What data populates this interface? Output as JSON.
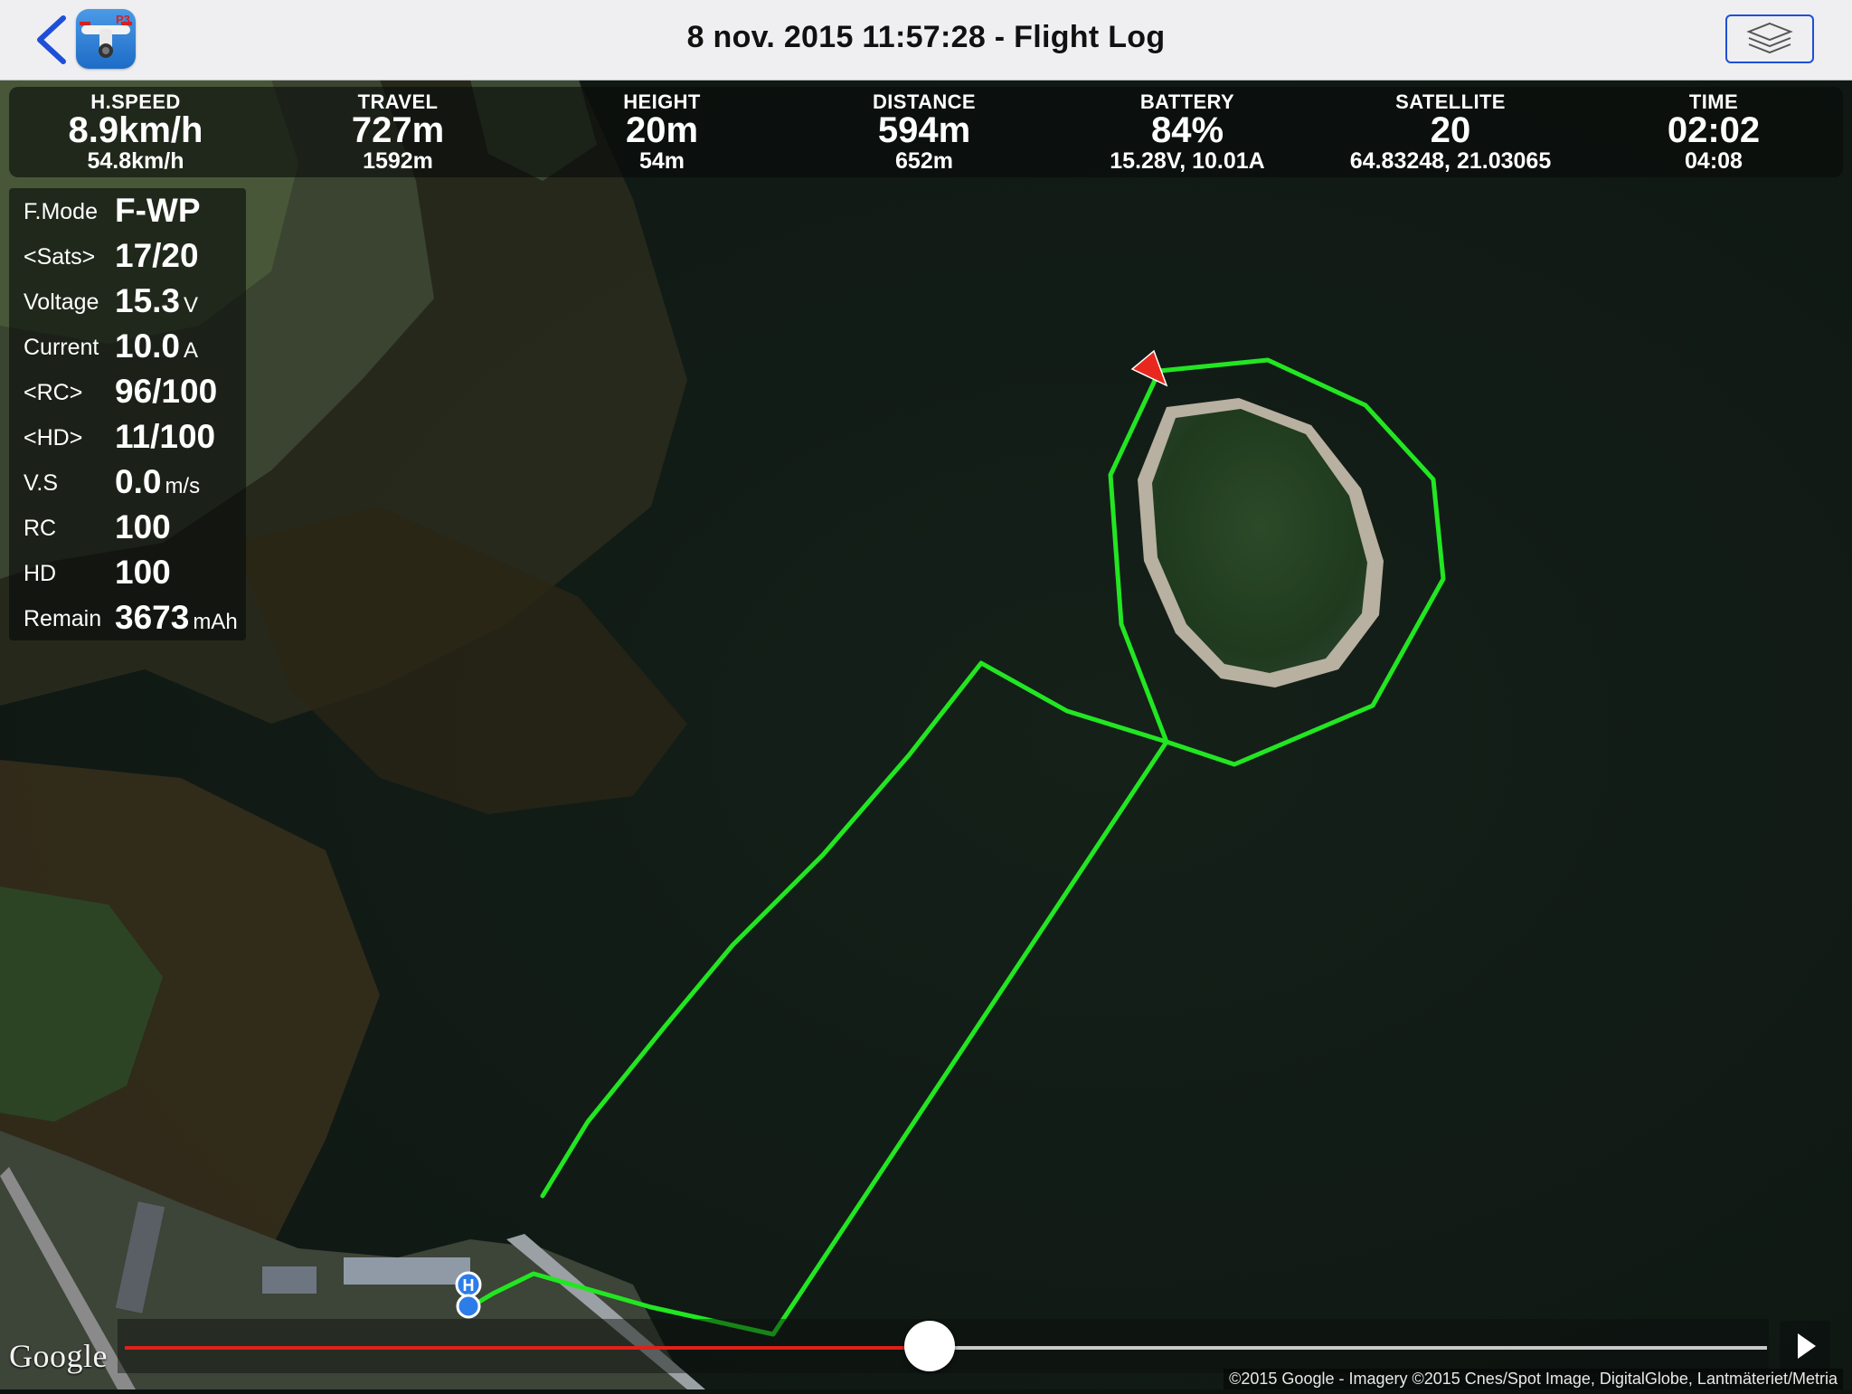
{
  "header": {
    "title": "8 nov. 2015 11:57:28 - Flight Log",
    "app_icon_badge": "P3",
    "back_icon": "chevron-left-icon",
    "layers_icon": "layers-icon"
  },
  "stats": [
    {
      "label": "H.SPEED",
      "value": "8.9km/h",
      "sub": "54.8km/h"
    },
    {
      "label": "TRAVEL",
      "value": "727m",
      "sub": "1592m"
    },
    {
      "label": "HEIGHT",
      "value": "20m",
      "sub": "54m"
    },
    {
      "label": "DISTANCE",
      "value": "594m",
      "sub": "652m"
    },
    {
      "label": "BATTERY",
      "value": "84%",
      "sub": "15.28V, 10.01A"
    },
    {
      "label": "SATELLITE",
      "value": "20",
      "sub": "64.83248, 21.03065"
    },
    {
      "label": "TIME",
      "value": "02:02",
      "sub": "04:08"
    }
  ],
  "telemetry": [
    {
      "key": "F.Mode",
      "value": "F-WP",
      "unit": ""
    },
    {
      "key": "<Sats>",
      "value": "17/20",
      "unit": ""
    },
    {
      "key": "Voltage",
      "value": "15.3",
      "unit": "V"
    },
    {
      "key": "Current",
      "value": "10.0",
      "unit": "A"
    },
    {
      "key": "<RC>",
      "value": "96/100",
      "unit": ""
    },
    {
      "key": "<HD>",
      "value": "11/100",
      "unit": ""
    },
    {
      "key": "V.S",
      "value": "0.0",
      "unit": "m/s"
    },
    {
      "key": "RC",
      "value": "100",
      "unit": ""
    },
    {
      "key": "HD",
      "value": "100",
      "unit": ""
    },
    {
      "key": "Remain",
      "value": "3673",
      "unit": "mAh"
    }
  ],
  "map": {
    "home_marker_label": "H",
    "flight_path_color": "#22e622",
    "aircraft_color": "#e8281e",
    "google_logo": "Google",
    "copyright": "©2015 Google - Imagery ©2015 Cnes/Spot Image, DigitalGlobe, Lantmäteriet/Metria"
  },
  "playback": {
    "progress": 0.49,
    "played_color": "#e0201a",
    "play_icon": "play-icon"
  }
}
